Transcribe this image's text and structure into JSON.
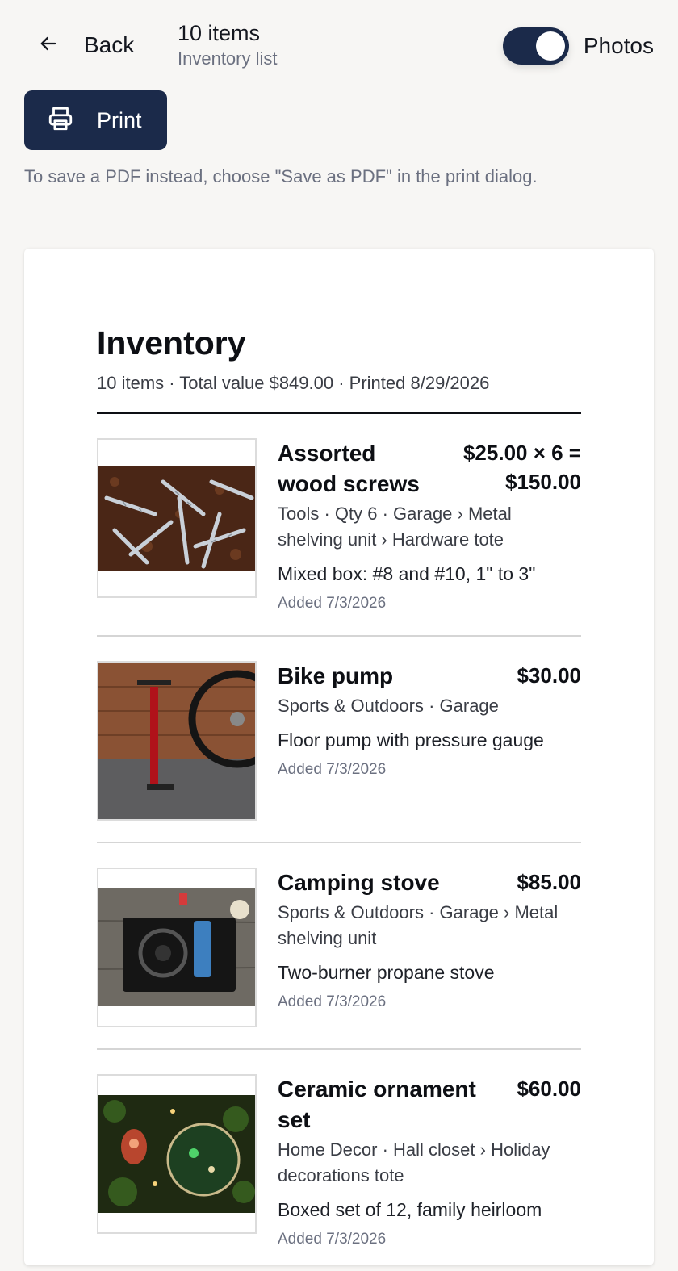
{
  "header": {
    "back_label": "Back",
    "title": "10 items",
    "subtitle": "Inventory list",
    "photos_label": "Photos",
    "photos_enabled": true,
    "print_label": "Print",
    "hint": "To save a PDF instead, choose \"Save as PDF\" in the print dialog."
  },
  "document": {
    "title": "Inventory",
    "meta": "10 items · Total value $849.00 · Printed 8/29/2026"
  },
  "items": [
    {
      "name": "Assorted wood screws",
      "price": "$25.00 × 6 = $150.00",
      "category": "Tools · Qty 6 · Garage › Metal shelving unit › Hardware tote",
      "description": "Mixed box: #8 and #10, 1\" to 3\"",
      "added": "Added 7/3/2026",
      "photo": "screws-photo"
    },
    {
      "name": "Bike pump",
      "price": "$30.00",
      "category": "Sports & Outdoors · Garage",
      "description": "Floor pump with pressure gauge",
      "added": "Added 7/3/2026",
      "photo": "bike-pump-photo"
    },
    {
      "name": "Camping stove",
      "price": "$85.00",
      "category": "Sports & Outdoors · Garage › Metal shelving unit",
      "description": "Two-burner propane stove",
      "added": "Added 7/3/2026",
      "photo": "camping-stove-photo"
    },
    {
      "name": "Ceramic ornament set",
      "price": "$60.00",
      "category": "Home Decor · Hall closet › Holiday decorations tote",
      "description": "Boxed set of 12, family heirloom",
      "added": "Added 7/3/2026",
      "photo": "ornament-photo"
    }
  ],
  "colors": {
    "primary": "#1b2a4a",
    "background": "#f7f6f4",
    "muted_text": "#6b7080"
  }
}
